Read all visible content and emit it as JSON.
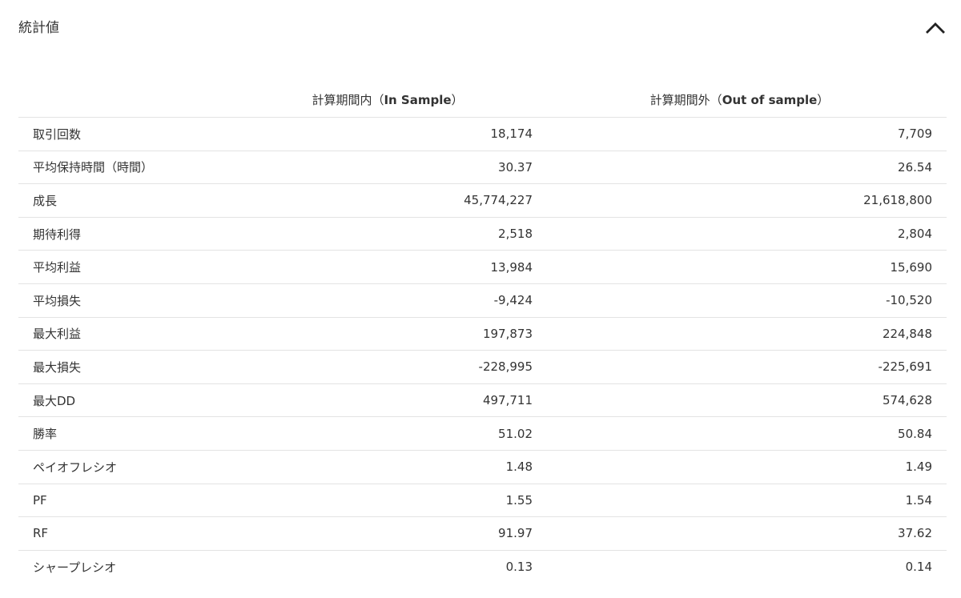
{
  "panel": {
    "title": "統計値"
  },
  "icons": {
    "collapse": "chevron-up-icon"
  },
  "table": {
    "header": {
      "in_sample_prefix": "計算期間内（",
      "in_sample_bold": "In Sample",
      "in_sample_suffix": "）",
      "out_sample_prefix": "計算期間外（",
      "out_sample_bold": "Out of sample",
      "out_sample_suffix": "）"
    },
    "rows": [
      {
        "label": "取引回数",
        "in_sample": "18,174",
        "out_sample": "7,709"
      },
      {
        "label": "平均保持時間（時間）",
        "in_sample": "30.37",
        "out_sample": "26.54"
      },
      {
        "label": "成長",
        "in_sample": "45,774,227",
        "out_sample": "21,618,800"
      },
      {
        "label": "期待利得",
        "in_sample": "2,518",
        "out_sample": "2,804"
      },
      {
        "label": "平均利益",
        "in_sample": "13,984",
        "out_sample": "15,690"
      },
      {
        "label": "平均損失",
        "in_sample": "-9,424",
        "out_sample": "-10,520"
      },
      {
        "label": "最大利益",
        "in_sample": "197,873",
        "out_sample": "224,848"
      },
      {
        "label": "最大損失",
        "in_sample": "-228,995",
        "out_sample": "-225,691"
      },
      {
        "label": "最大DD",
        "in_sample": "497,711",
        "out_sample": "574,628"
      },
      {
        "label": "勝率",
        "in_sample": "51.02",
        "out_sample": "50.84"
      },
      {
        "label": "ペイオフレシオ",
        "in_sample": "1.48",
        "out_sample": "1.49"
      },
      {
        "label": "PF",
        "in_sample": "1.55",
        "out_sample": "1.54"
      },
      {
        "label": "RF",
        "in_sample": "91.97",
        "out_sample": "37.62"
      },
      {
        "label": "シャープレシオ",
        "in_sample": "0.13",
        "out_sample": "0.14"
      }
    ]
  }
}
